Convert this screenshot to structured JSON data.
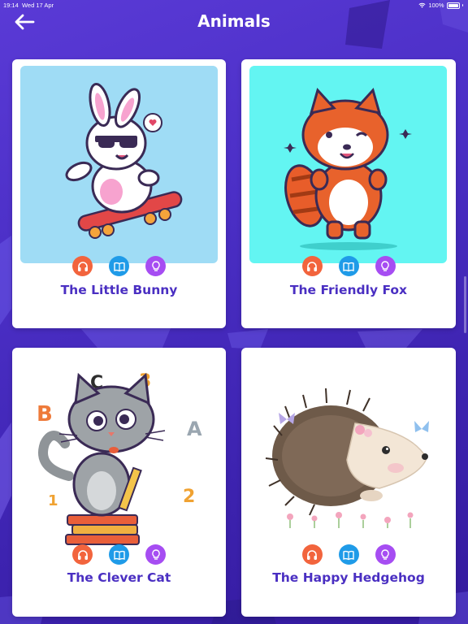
{
  "status_bar": {
    "time": "19:14",
    "date": "Wed 17 Apr",
    "battery": "100%"
  },
  "header": {
    "title": "Animals",
    "back_icon": "arrow-left-icon"
  },
  "stories": [
    {
      "title": "The Little Bunny",
      "image": "bunny-skateboard-illustration",
      "bg": "#9fdcf5"
    },
    {
      "title": "The Friendly Fox",
      "image": "red-panda-thumbs-up-illustration",
      "bg": "#63f5f2"
    },
    {
      "title": "The Clever Cat",
      "image": "cat-on-books-illustration",
      "bg": "#ffffff"
    },
    {
      "title": "The Happy Hedgehog",
      "image": "hedgehog-flowers-illustration",
      "bg": "#ffffff"
    }
  ],
  "actions": [
    {
      "name": "audio",
      "icon": "headphones-icon",
      "color": "#f2643d"
    },
    {
      "name": "read",
      "icon": "book-icon",
      "color": "#1f9be8"
    },
    {
      "name": "idea",
      "icon": "lightbulb-icon",
      "color": "#a64df2"
    }
  ]
}
